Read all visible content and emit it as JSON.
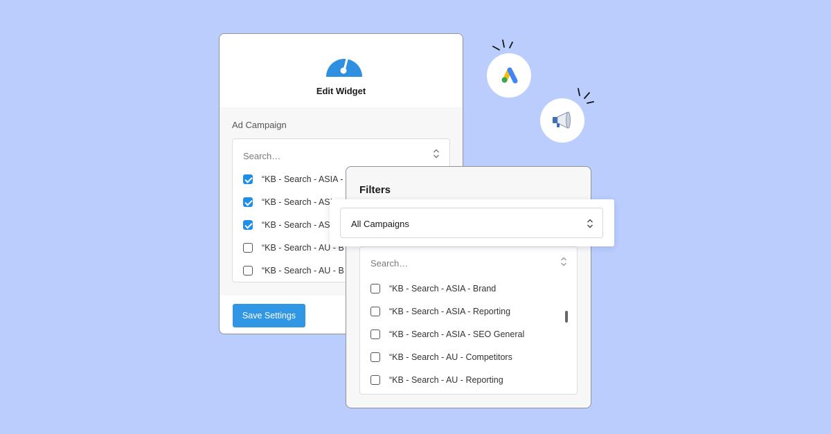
{
  "edit_widget": {
    "title": "Edit Widget",
    "section_label": "Ad Campaign",
    "search_placeholder": "Search…",
    "items": [
      {
        "label": "“KB - Search - ASIA -",
        "checked": true
      },
      {
        "label": "“KB - Search - ASI",
        "checked": true
      },
      {
        "label": "“KB - Search - ASI",
        "checked": true
      },
      {
        "label": "“KB - Search - AU - B",
        "checked": false
      },
      {
        "label": "“KB - Search - AU - B",
        "checked": false
      }
    ],
    "save_label": "Save Settings"
  },
  "filters": {
    "title": "Filters",
    "selected_value": "All Campaigns",
    "search_placeholder": "Search…",
    "items": [
      {
        "label": "“KB - Search - ASIA - Brand",
        "checked": false
      },
      {
        "label": "“KB - Search - ASIA - Reporting",
        "checked": false
      },
      {
        "label": "“KB - Search - ASIA - SEO General",
        "checked": false
      },
      {
        "label": "“KB - Search - AU - Competitors",
        "checked": false
      },
      {
        "label": "“KB - Search - AU - Reporting",
        "checked": false
      }
    ]
  },
  "icons": {
    "gauge": "gauge-icon",
    "google_ads": "google-ads-logo-icon",
    "megaphone": "megaphone-icon",
    "chevron": "chevron-up-down-icon"
  },
  "colors": {
    "background": "#bacdfd",
    "accent": "#3197e4",
    "checkbox_checked": "#1f8ee8"
  }
}
